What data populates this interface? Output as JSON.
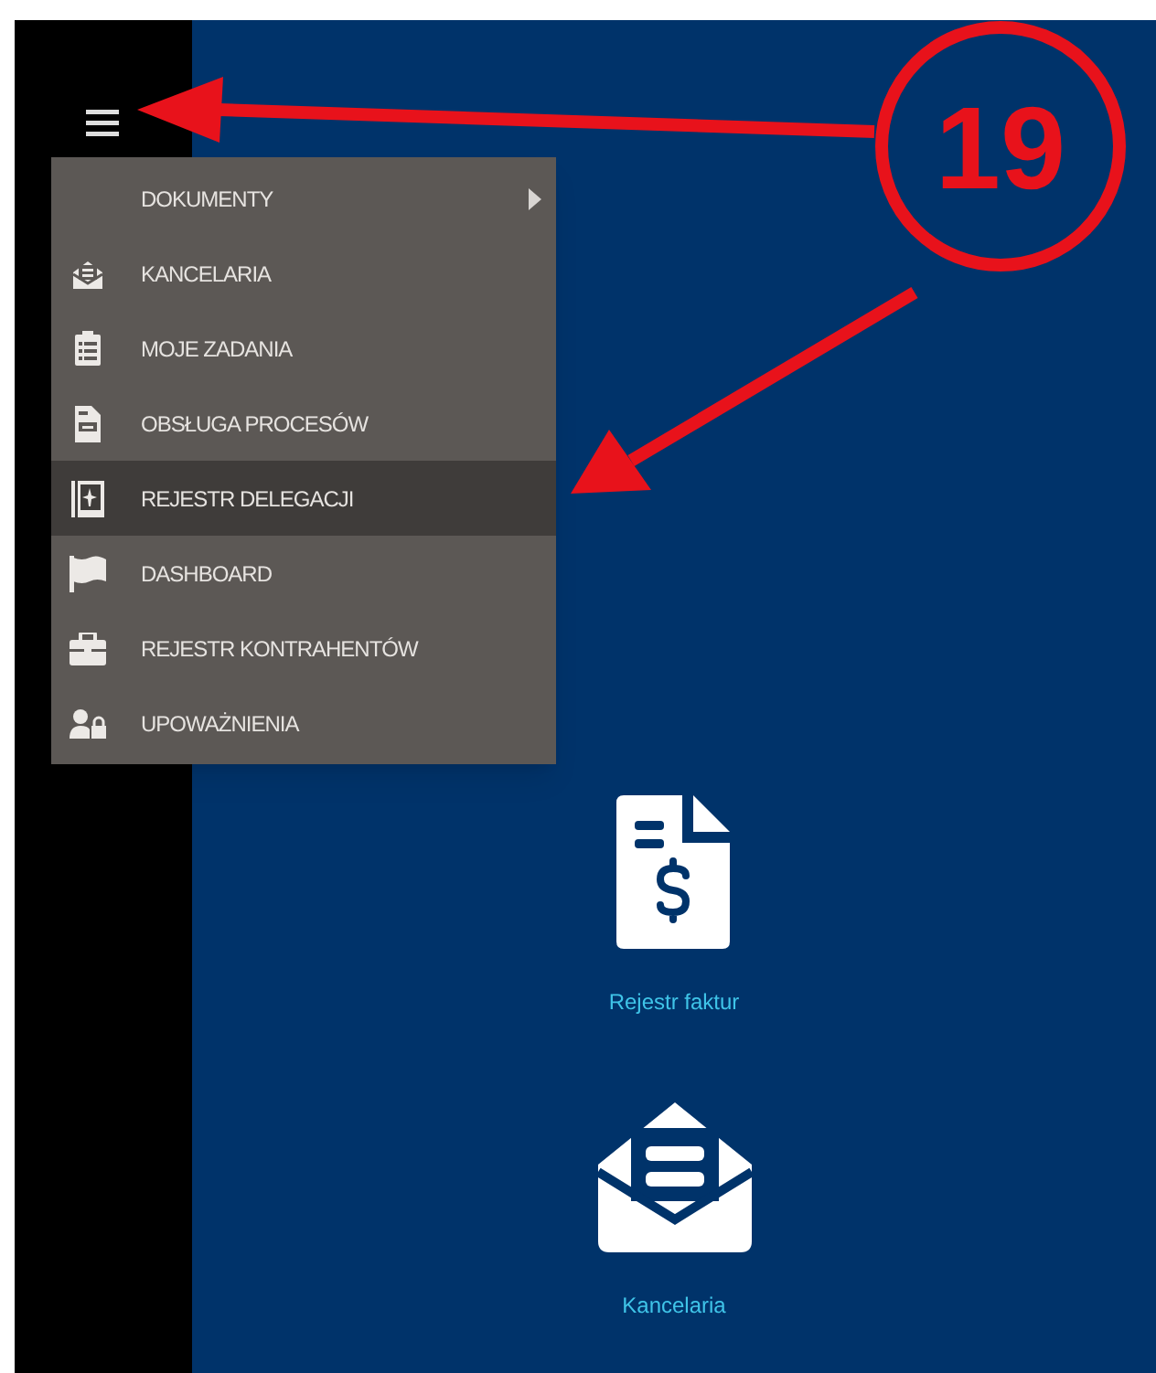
{
  "menu": {
    "items": [
      {
        "label": "DOKUMENTY",
        "has_submenu": true,
        "selected": false
      },
      {
        "label": "KANCELARIA",
        "has_submenu": false,
        "selected": false
      },
      {
        "label": "MOJE ZADANIA",
        "has_submenu": false,
        "selected": false
      },
      {
        "label": "OBSŁUGA PROCESÓW",
        "has_submenu": false,
        "selected": false
      },
      {
        "label": "REJESTR DELEGACJI",
        "has_submenu": false,
        "selected": true
      },
      {
        "label": "DASHBOARD",
        "has_submenu": false,
        "selected": false
      },
      {
        "label": "REJESTR KONTRAHENTÓW",
        "has_submenu": false,
        "selected": false
      },
      {
        "label": "UPOWAŻNIENIA",
        "has_submenu": false,
        "selected": false
      }
    ]
  },
  "tiles": [
    {
      "label": "Rejestr faktur"
    },
    {
      "label": "Kancelaria"
    }
  ],
  "annotation": {
    "label": "19"
  }
}
